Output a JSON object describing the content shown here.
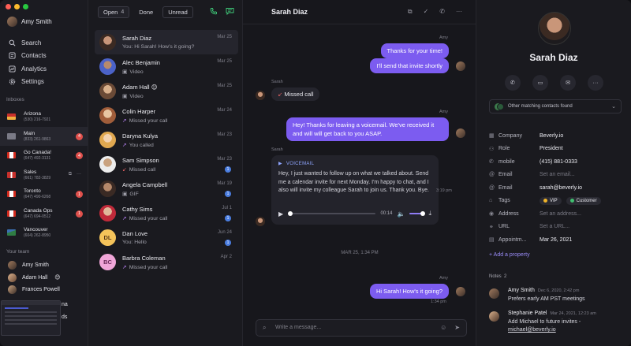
{
  "sidebar": {
    "user_name": "Amy Smith",
    "nav": [
      {
        "label": "Search",
        "icon": "search-icon"
      },
      {
        "label": "Contacts",
        "icon": "contacts-icon"
      },
      {
        "label": "Analytics",
        "icon": "analytics-icon"
      },
      {
        "label": "Settings",
        "icon": "gear-icon"
      }
    ],
    "inboxes_label": "Inboxes",
    "inboxes": [
      {
        "name": "Arizona",
        "phone": "(530) 216-7921",
        "flag": "arizona-flag-icon",
        "badge": ""
      },
      {
        "name": "Main",
        "phone": "(833) 261-9863",
        "flag": "building-icon",
        "badge": "4"
      },
      {
        "name": "Go Canada!",
        "phone": "(647) 492-3131",
        "flag": "canada-flag-icon",
        "badge": "4"
      },
      {
        "name": "Sales",
        "phone": "(661) 782-3829",
        "flag": "uk-flag-icon",
        "badge": ""
      },
      {
        "name": "Toronto",
        "phone": "(647) 490-6268",
        "flag": "canada-flag-icon",
        "badge": "1"
      },
      {
        "name": "Canada Ops",
        "phone": "(647) 694-0512",
        "flag": "canada-flag-icon",
        "badge": "1"
      },
      {
        "name": "Vancouver",
        "phone": "(604) 262-8950",
        "flag": "mountain-icon",
        "badge": ""
      }
    ],
    "team_label": "Your team",
    "team": [
      {
        "name": "Amy Smith",
        "emoji": ""
      },
      {
        "name": "Adam Hall",
        "emoji": "😊"
      },
      {
        "name": "Frances Powell",
        "emoji": ""
      }
    ],
    "partial_items": [
      "na",
      "ds"
    ]
  },
  "convlist": {
    "tabs": {
      "open_label": "Open",
      "open_count": "4",
      "done_label": "Done",
      "unread_label": "Unread"
    },
    "conversations": [
      {
        "name": "Sarah Diaz",
        "preview": "You: Hi Sarah! How's it going?",
        "date": "Mar 25",
        "kind": "text",
        "unread": "",
        "emoji": ""
      },
      {
        "name": "Alec Benjamin",
        "preview": "Video",
        "date": "Mar 25",
        "kind": "media",
        "unread": "",
        "emoji": ""
      },
      {
        "name": "Adam Hall",
        "preview": "Video",
        "date": "Mar 25",
        "kind": "media",
        "unread": "",
        "emoji": "😊"
      },
      {
        "name": "Colin Harper",
        "preview": "Missed your call",
        "date": "Mar 24",
        "kind": "missed",
        "unread": "",
        "emoji": ""
      },
      {
        "name": "Daryna Kulya",
        "preview": "You called",
        "date": "Mar 23",
        "kind": "outgoing",
        "unread": "",
        "emoji": ""
      },
      {
        "name": "Sam Simpson",
        "preview": "Missed call",
        "date": "Mar 23",
        "kind": "missed",
        "unread": "1",
        "emoji": ""
      },
      {
        "name": "Angela Campbell",
        "preview": "GIF",
        "date": "Mar 19",
        "kind": "media",
        "unread": "1",
        "emoji": ""
      },
      {
        "name": "Cathy Sims",
        "preview": "Missed your call",
        "date": "Jul 1",
        "kind": "outgoing",
        "unread": "1",
        "emoji": ""
      },
      {
        "name": "Dan Love",
        "preview": "You: Hello",
        "date": "Jun 24",
        "kind": "text",
        "unread": "1",
        "emoji": "",
        "initials": "DL"
      },
      {
        "name": "Barbra Coleman",
        "preview": "Missed your call",
        "date": "Apr 2",
        "kind": "outgoing",
        "unread": "",
        "emoji": "",
        "initials": "BC"
      }
    ]
  },
  "chat": {
    "title": "Sarah Diaz",
    "messages": {
      "sender_amy": "Amy",
      "sender_sarah": "Sarah",
      "out1": "Thanks for your time!",
      "out2": "I'll send that invite shortly",
      "missed": "Missed call",
      "out3": "Hey! Thanks for leaving a voicemail. We've received it and will will get back to you ASAP.",
      "vm_label": "VOICEMAIL",
      "vm_text": "Hey, I just wanted to follow up on what we talked about. Send me a calendar invite for next Monday. I'm happy to chat, and I also will invite my colleague Sarah to join us. Thank you. Bye.",
      "vm_time": "00:14",
      "vm_progress": 0,
      "vm_volume": 0.8,
      "vm_side_time": "3:19 pm",
      "divider": "MAR 25, 1:34 PM",
      "out4": "Hi Sarah! How's it going?",
      "out4_time": "1:34 pm"
    },
    "composer_placeholder": "Write a message..."
  },
  "contact": {
    "name": "Sarah Diaz",
    "matching": "Other matching contacts found",
    "properties": [
      {
        "key": "Company",
        "value": "Beverly.io",
        "icon": "building-icon",
        "muted": false
      },
      {
        "key": "Role",
        "value": "President",
        "icon": "person-icon",
        "muted": false
      },
      {
        "key": "mobile",
        "value": "(415) 881-0333",
        "icon": "phone-icon",
        "muted": false
      },
      {
        "key": "Email",
        "value": "Set an email...",
        "icon": "at-icon",
        "muted": true
      },
      {
        "key": "Email",
        "value": "sarah@beverly.io",
        "icon": "at-icon",
        "muted": false
      },
      {
        "key": "Tags",
        "value": "",
        "icon": "tag-icon",
        "muted": false
      },
      {
        "key": "Address",
        "value": "Set an address...",
        "icon": "location-icon",
        "muted": true
      },
      {
        "key": "URL",
        "value": "Set a URL...",
        "icon": "link-icon",
        "muted": true
      },
      {
        "key": "Appointm...",
        "value": "Mar 26, 2021",
        "icon": "calendar-icon",
        "muted": false
      }
    ],
    "tags": [
      {
        "label": "VIP",
        "color": "#f0b429"
      },
      {
        "label": "Customer",
        "color": "#40c070"
      }
    ],
    "add_property": "+ Add a property",
    "notes_label": "Notes",
    "notes_count": "2",
    "notes": [
      {
        "author": "Amy Smith",
        "date": "Dec 6, 2020, 2:42 pm",
        "text": "Prefers early AM PST meetings",
        "link": ""
      },
      {
        "author": "Stephanie Patel",
        "date": "Mar 24, 2021, 12:23 am",
        "text": "Add Michael to future invites - ",
        "link": "michael@beverly.io"
      }
    ]
  },
  "colors": {
    "accent": "#7c5cf0",
    "call_green": "#40d07c",
    "badge_red": "#e0504c",
    "unread_blue": "#4a7de0"
  }
}
